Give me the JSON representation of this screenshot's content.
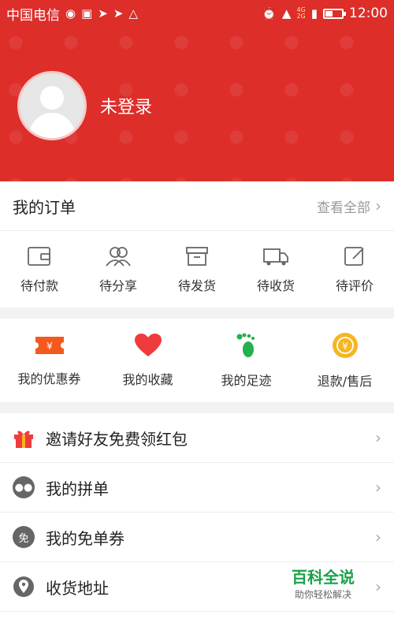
{
  "status_bar": {
    "carrier": "中国电信",
    "network": "4G",
    "network2": "2G",
    "time": "12:00"
  },
  "profile": {
    "login_text": "未登录"
  },
  "orders": {
    "title": "我的订单",
    "view_all": "查看全部",
    "items": [
      {
        "label": "待付款",
        "icon": "wallet-icon"
      },
      {
        "label": "待分享",
        "icon": "share-people-icon"
      },
      {
        "label": "待发货",
        "icon": "package-box-icon"
      },
      {
        "label": "待收货",
        "icon": "truck-icon"
      },
      {
        "label": "待评价",
        "icon": "edit-review-icon"
      }
    ]
  },
  "services": [
    {
      "label": "我的优惠券",
      "icon": "coupon-icon",
      "color": "#f25a1d"
    },
    {
      "label": "我的收藏",
      "icon": "heart-icon",
      "color": "#ef3b3b"
    },
    {
      "label": "我的足迹",
      "icon": "footprint-icon",
      "color": "#22b14c"
    },
    {
      "label": "退款/售后",
      "icon": "refund-icon",
      "color": "#f7b520"
    }
  ],
  "menu": [
    {
      "label": "邀请好友免费领红包",
      "icon": "gift-icon"
    },
    {
      "label": "我的拼单",
      "icon": "group-order-icon"
    },
    {
      "label": "我的免单券",
      "icon": "free-coupon-icon",
      "icon_text": "免"
    },
    {
      "label": "收货地址",
      "icon": "location-pin-icon"
    }
  ],
  "watermark": {
    "title": "百科全说",
    "subtitle": "助你轻松解决"
  },
  "colors": {
    "brand_red": "#dd2e2a"
  }
}
